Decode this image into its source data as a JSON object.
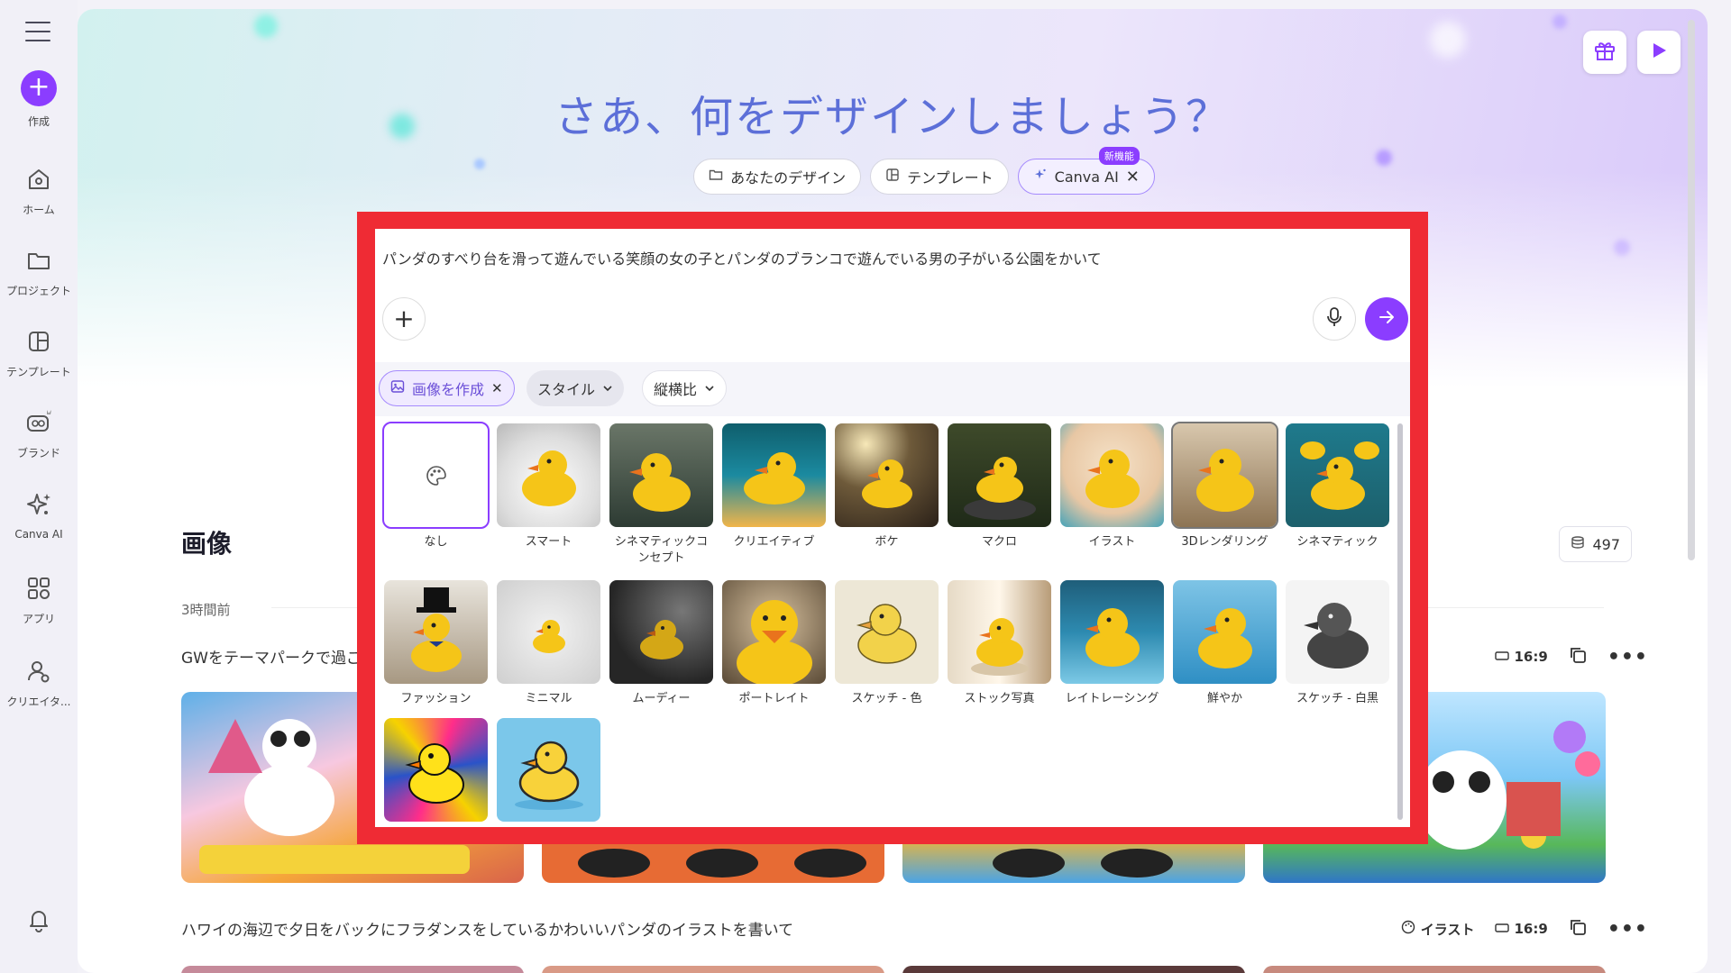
{
  "sidebar": {
    "items": [
      {
        "label": "作成",
        "icon": "plus-icon"
      },
      {
        "label": "ホーム",
        "icon": "home-icon"
      },
      {
        "label": "プロジェクト",
        "icon": "folder-icon"
      },
      {
        "label": "テンプレート",
        "icon": "template-icon"
      },
      {
        "label": "ブランド",
        "icon": "brand-icon"
      },
      {
        "label": "Canva AI",
        "icon": "sparkle-icon"
      },
      {
        "label": "アプリ",
        "icon": "apps-icon"
      },
      {
        "label": "クリエイタ...",
        "icon": "creator-icon"
      }
    ]
  },
  "hero": {
    "title": "さあ、何をデザインしましょう？",
    "tabs": [
      {
        "label": "あなたのデザイン",
        "icon": "folder-icon"
      },
      {
        "label": "テンプレート",
        "icon": "template-icon"
      },
      {
        "label": "Canva AI",
        "icon": "sparkle-icon",
        "badge": "新機能",
        "active": true
      }
    ]
  },
  "prompt": {
    "text": "パンダのすべり台を滑って遊んでいる笑顔の女の子とパンダのブランコで遊んでいる男の子がいる公園をかいて",
    "options": {
      "create_image": "画像を作成",
      "style": "スタイル",
      "aspect": "縦横比"
    },
    "styles": [
      {
        "label": "なし"
      },
      {
        "label": "スマート"
      },
      {
        "label": "シネマティックコンセプト"
      },
      {
        "label": "クリエイティブ"
      },
      {
        "label": "ボケ"
      },
      {
        "label": "マクロ"
      },
      {
        "label": "イラスト"
      },
      {
        "label": "3Dレンダリング"
      },
      {
        "label": "シネマティック"
      },
      {
        "label": "ファッション"
      },
      {
        "label": "ミニマル"
      },
      {
        "label": "ムーディー"
      },
      {
        "label": "ポートレイト"
      },
      {
        "label": "スケッチ - 色"
      },
      {
        "label": "ストック写真"
      },
      {
        "label": "レイトレーシング"
      },
      {
        "label": "鮮やか"
      },
      {
        "label": "スケッチ - 白黒"
      },
      {
        "label": ""
      },
      {
        "label": ""
      }
    ]
  },
  "images_section": {
    "title": "画像",
    "credits": "497",
    "time_label": "3時間前",
    "rows": [
      {
        "prompt": "GWをテーマパークで過ご",
        "aspect": "16:9"
      },
      {
        "prompt": "ハワイの海辺で夕日をバックにフラダンスをしているかわいいパンダのイラストを書いて",
        "style": "イラスト",
        "aspect": "16:9"
      }
    ]
  },
  "colors": {
    "accent": "#8b3dff",
    "highlight_frame": "#ef2b34",
    "title": "#5c6fd8"
  }
}
